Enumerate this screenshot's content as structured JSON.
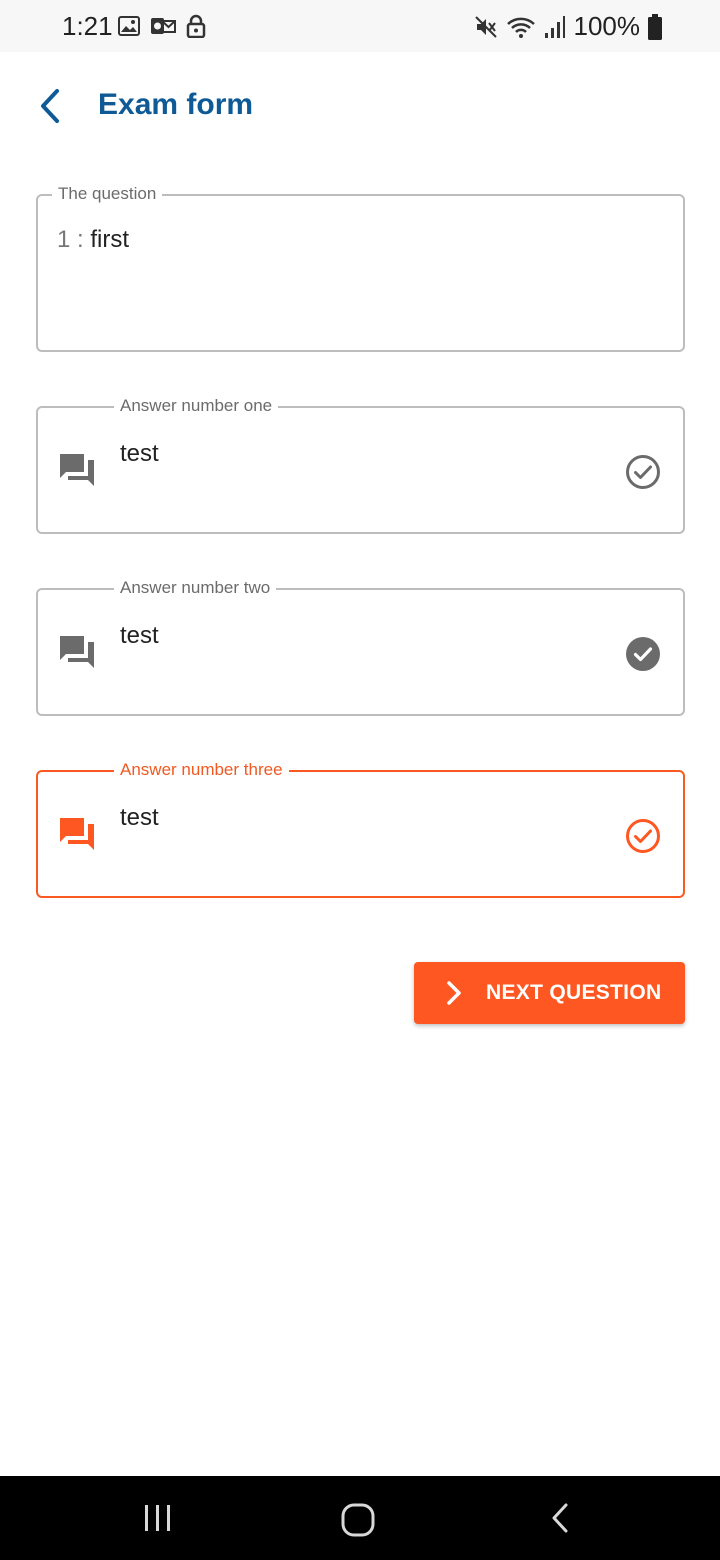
{
  "status_bar": {
    "time": "1:21",
    "battery_text": "100%",
    "left_icons": [
      "image-icon",
      "outlook-icon",
      "lock-icon"
    ],
    "right_icons": [
      "mute-icon",
      "wifi-icon",
      "signal-icon",
      "battery-icon"
    ]
  },
  "header": {
    "title": "Exam form",
    "back_icon": "chevron-left-icon"
  },
  "question": {
    "legend": "The question",
    "number": "1 : ",
    "text": "first"
  },
  "answers": [
    {
      "legend": "Answer number one",
      "value": "test",
      "icon": "question-answer-icon",
      "check_icon": "check-circle-outline-icon"
    },
    {
      "legend": "Answer number two",
      "value": "test",
      "icon": "question-answer-icon",
      "check_icon": "check-circle-filled-icon"
    },
    {
      "legend": "Answer number three",
      "value": "test",
      "icon": "question-answer-icon",
      "check_icon": "check-circle-outline-icon"
    }
  ],
  "next_button": {
    "label": "NEXT QUESTION",
    "icon": "chevron-right-icon"
  },
  "nav": [
    "recents-icon",
    "home-icon",
    "back-icon"
  ],
  "colors": {
    "primary": "#0d5a96",
    "accent": "#fe5722",
    "border": "#bdbdbd",
    "icon_grey": "#6b6b6b"
  }
}
